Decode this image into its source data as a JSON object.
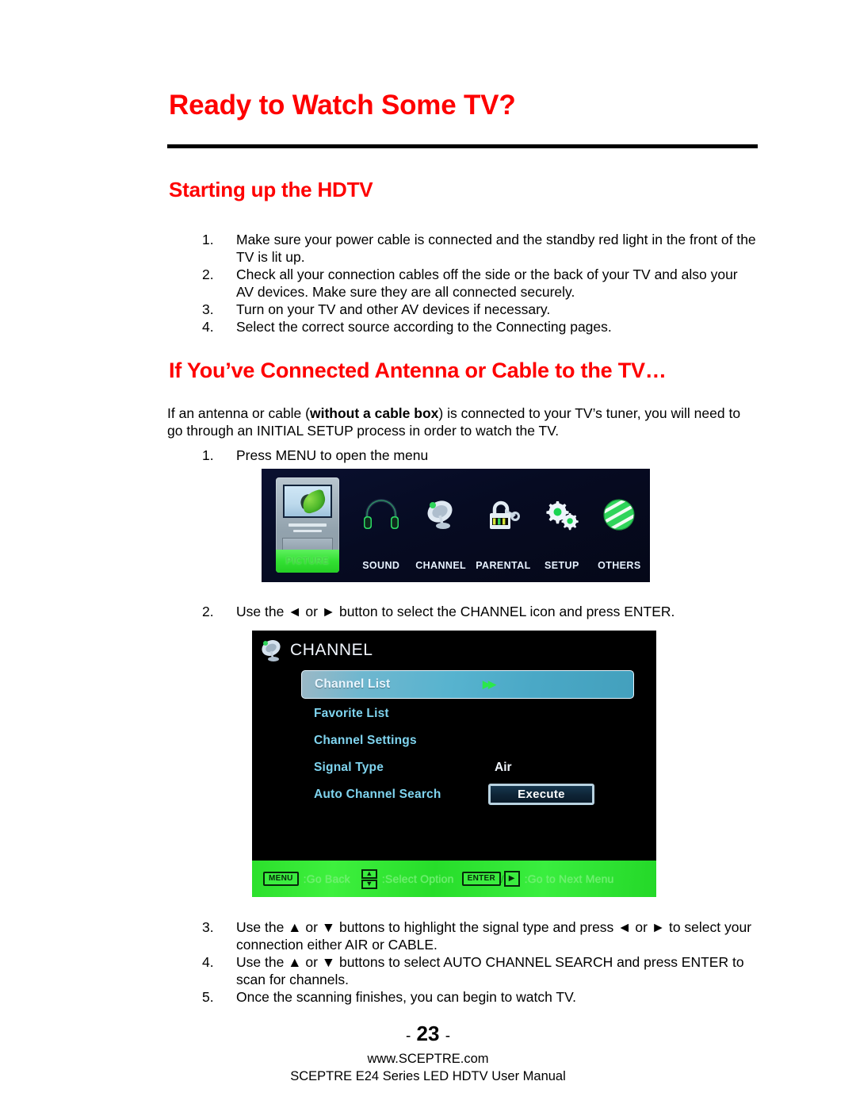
{
  "document": {
    "title": "Ready to Watch Some TV?",
    "sections": [
      {
        "heading": "Starting up the HDTV"
      },
      {
        "heading": "If You’ve Connected Antenna or Cable to the TV…"
      }
    ],
    "startup_steps": [
      {
        "num": "1.",
        "text": "Make sure your power cable is connected and the standby red light in the front of the TV is lit up."
      },
      {
        "num": "2.",
        "text": "Check all your connection cables off the side or the back of your TV and also your AV devices.  Make sure they are all connected securely."
      },
      {
        "num": "3.",
        "text": "Turn on your TV and other AV devices if necessary."
      },
      {
        "num": "4.",
        "text": "Select the correct source according to the Connecting pages."
      }
    ],
    "intro_paragraph": {
      "before_bold": "If an antenna or cable (",
      "bold": "without a cable box",
      "after_bold": ") is connected to your TV’s tuner, you will need to go through an INITIAL SETUP process in order to watch the TV."
    },
    "antenna_steps_top": [
      {
        "num": "1.",
        "text": "Press MENU to open the menu"
      }
    ],
    "antenna_steps_mid": [
      {
        "num": "2.",
        "text": "Use the ◄ or ► button to select the CHANNEL icon and press ENTER."
      }
    ],
    "antenna_steps_bottom": [
      {
        "num": "3.",
        "text": "Use the ▲ or ▼ buttons to highlight the signal type and press ◄ or ► to select your connection either AIR or CABLE."
      },
      {
        "num": "4.",
        "text": "Use the ▲ or ▼ buttons to select AUTO CHANNEL SEARCH and press ENTER to scan for channels."
      },
      {
        "num": "5.",
        "text": "Once the scanning finishes, you can begin to watch TV."
      }
    ],
    "footer": {
      "page_dash_left": "-",
      "page_number": "23",
      "page_dash_right": "-",
      "website": "www.SCEPTRE.com",
      "manual_line": "SCEPTRE E24 Series LED HDTV User Manual"
    }
  },
  "tv_main_menu": {
    "items": [
      {
        "label": "PICTURE",
        "icon": "picture-tv-icon",
        "selected": true
      },
      {
        "label": "SOUND",
        "icon": "headphones-icon",
        "selected": false
      },
      {
        "label": "CHANNEL",
        "icon": "satellite-dish-icon",
        "selected": false
      },
      {
        "label": "PARENTAL",
        "icon": "padlock-icon",
        "selected": false
      },
      {
        "label": "SETUP",
        "icon": "gears-icon",
        "selected": false
      },
      {
        "label": "OTHERS",
        "icon": "globe-icon",
        "selected": false
      }
    ]
  },
  "tv_channel_menu": {
    "title": "CHANNEL",
    "rows": [
      {
        "label": "Channel List",
        "value": "",
        "arrows": "▶▶",
        "selected": true,
        "kind": "arrows"
      },
      {
        "label": "Favorite List",
        "value": "",
        "selected": false,
        "kind": "plain"
      },
      {
        "label": "Channel Settings",
        "value": "",
        "selected": false,
        "kind": "plain"
      },
      {
        "label": "Signal Type",
        "value": "Air",
        "selected": false,
        "kind": "value"
      },
      {
        "label": "Auto Channel Search",
        "value": "Execute",
        "selected": false,
        "kind": "button"
      }
    ],
    "footer": {
      "menu_key": "MENU",
      "menu_action": ":Go Back",
      "updown_action": ":Select Option",
      "enter_key": "ENTER",
      "slash": "/",
      "enter_action": ":Go to Next Menu"
    }
  },
  "colors": {
    "heading_red": "#fe0000",
    "menu_highlight_green": "#33e033",
    "channel_label_blue": "#7fd4ef",
    "footer_bar_green": "#2ce02c"
  }
}
